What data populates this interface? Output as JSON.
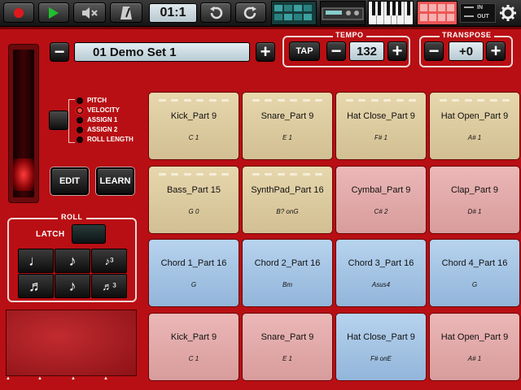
{
  "toolbar": {
    "counter": "01:1",
    "colors": {
      "record": "#e0181c",
      "play": "#20c030"
    },
    "io": {
      "in": "IN",
      "out": "OUT"
    }
  },
  "demo_set": {
    "name": "01 Demo Set 1"
  },
  "tempo": {
    "title": "TEMPO",
    "tap": "TAP",
    "value": "132"
  },
  "transpose": {
    "title": "TRANSPOSE",
    "value": "+0"
  },
  "modes": [
    {
      "label": "PITCH",
      "active": false
    },
    {
      "label": "VELOCITY",
      "active": true
    },
    {
      "label": "ASSIGN 1",
      "active": false
    },
    {
      "label": "ASSIGN 2",
      "active": false
    },
    {
      "label": "ROLL LENGTH",
      "active": false
    }
  ],
  "buttons": {
    "edit": "EDIT",
    "learn": "LEARN"
  },
  "roll": {
    "title": "ROLL",
    "latch": "LATCH",
    "notes": [
      "♩",
      "♪",
      "♪³",
      "♬",
      "♪",
      "♬³"
    ]
  },
  "pads": [
    {
      "name": "Kick_Part 9",
      "note": "C 1",
      "color": "tan"
    },
    {
      "name": "Snare_Part 9",
      "note": "E 1",
      "color": "tan"
    },
    {
      "name": "Hat Close_Part 9",
      "note": "F# 1",
      "color": "tan"
    },
    {
      "name": "Hat Open_Part 9",
      "note": "A# 1",
      "color": "tan"
    },
    {
      "name": "Bass_Part 15",
      "note": "G 0",
      "color": "tan"
    },
    {
      "name": "SynthPad_Part 16",
      "note": "B? onG",
      "color": "tan"
    },
    {
      "name": "Cymbal_Part 9",
      "note": "C# 2",
      "color": "pink"
    },
    {
      "name": "Clap_Part 9",
      "note": "D# 1",
      "color": "pink"
    },
    {
      "name": "Chord 1_Part 16",
      "note": "G",
      "color": "blue"
    },
    {
      "name": "Chord 2_Part 16",
      "note": "Bm",
      "color": "blue"
    },
    {
      "name": "Chord 3_Part 16",
      "note": "Asus4",
      "color": "blue"
    },
    {
      "name": "Chord 4_Part 16",
      "note": "G",
      "color": "blue"
    },
    {
      "name": "Kick_Part 9",
      "note": "C 1",
      "color": "pink"
    },
    {
      "name": "Snare_Part 9",
      "note": "E 1",
      "color": "pink"
    },
    {
      "name": "Hat Close_Part 9",
      "note": "F# onE",
      "color": "blue"
    },
    {
      "name": "Hat Open_Part 9",
      "note": "A# 1",
      "color": "pink"
    }
  ]
}
